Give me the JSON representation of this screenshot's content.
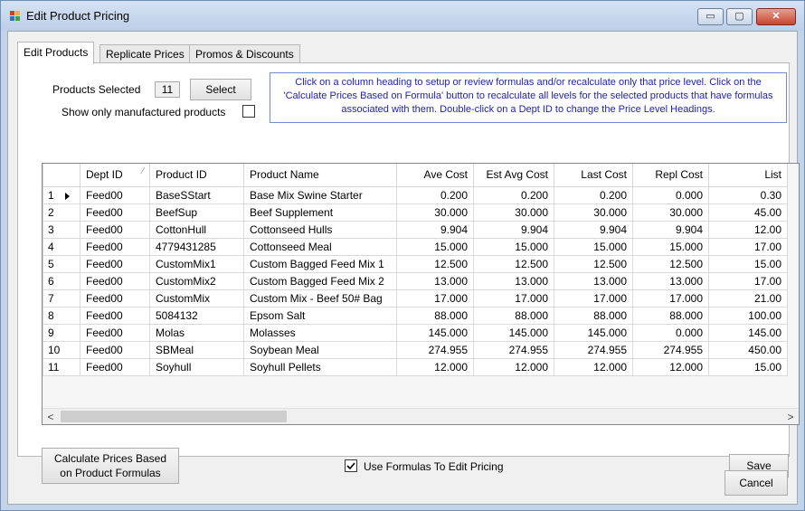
{
  "window": {
    "title": "Edit Product Pricing",
    "controls": {
      "minimize": "▭",
      "maximize": "▢",
      "close": "✕"
    }
  },
  "tabs": [
    {
      "label": "Edit Products",
      "active": true
    },
    {
      "label": "Replicate Prices",
      "active": false
    },
    {
      "label": "Promos & Discounts",
      "active": false
    }
  ],
  "selection": {
    "products_selected_label": "Products Selected",
    "products_selected_count": "11",
    "select_button": "Select",
    "manufactured_label": "Show only manufactured products",
    "manufactured_checked": false
  },
  "info_text": "Click on a column heading to setup or review formulas and/or recalculate only that price level. Click on the 'Calculate Prices Based on Formula' button to recalculate all levels for the selected products that have formulas associated with them. Double-click on a Dept ID to change the Price Level Headings.",
  "grid": {
    "columns": [
      "Dept ID",
      "Product ID",
      "Product Name",
      "Ave Cost",
      "Est Avg Cost",
      "Last Cost",
      "Repl Cost",
      "List"
    ],
    "sort_glyph": "⁄",
    "rows": [
      {
        "n": "1",
        "dept": "Feed00",
        "pid": "BaseSStart",
        "name": "Base Mix Swine Starter",
        "ave": "0.200",
        "est": "0.200",
        "last": "0.200",
        "repl": "0.000",
        "list": "0.30"
      },
      {
        "n": "2",
        "dept": "Feed00",
        "pid": "BeefSup",
        "name": "Beef Supplement",
        "ave": "30.000",
        "est": "30.000",
        "last": "30.000",
        "repl": "30.000",
        "list": "45.00"
      },
      {
        "n": "3",
        "dept": "Feed00",
        "pid": "CottonHull",
        "name": "Cottonseed Hulls",
        "ave": "9.904",
        "est": "9.904",
        "last": "9.904",
        "repl": "9.904",
        "list": "12.00"
      },
      {
        "n": "4",
        "dept": "Feed00",
        "pid": "4779431285",
        "name": "Cottonseed Meal",
        "ave": "15.000",
        "est": "15.000",
        "last": "15.000",
        "repl": "15.000",
        "list": "17.00"
      },
      {
        "n": "5",
        "dept": "Feed00",
        "pid": "CustomMix1",
        "name": "Custom Bagged Feed Mix 1",
        "ave": "12.500",
        "est": "12.500",
        "last": "12.500",
        "repl": "12.500",
        "list": "15.00"
      },
      {
        "n": "6",
        "dept": "Feed00",
        "pid": "CustomMix2",
        "name": "Custom Bagged Feed Mix 2",
        "ave": "13.000",
        "est": "13.000",
        "last": "13.000",
        "repl": "13.000",
        "list": "17.00"
      },
      {
        "n": "7",
        "dept": "Feed00",
        "pid": "CustomMix",
        "name": "Custom Mix - Beef 50# Bag",
        "ave": "17.000",
        "est": "17.000",
        "last": "17.000",
        "repl": "17.000",
        "list": "21.00"
      },
      {
        "n": "8",
        "dept": "Feed00",
        "pid": "5084132",
        "name": "Epsom Salt",
        "ave": "88.000",
        "est": "88.000",
        "last": "88.000",
        "repl": "88.000",
        "list": "100.00"
      },
      {
        "n": "9",
        "dept": "Feed00",
        "pid": "Molas",
        "name": "Molasses",
        "ave": "145.000",
        "est": "145.000",
        "last": "145.000",
        "repl": "0.000",
        "list": "145.00"
      },
      {
        "n": "10",
        "dept": "Feed00",
        "pid": "SBMeal",
        "name": "Soybean Meal",
        "ave": "274.955",
        "est": "274.955",
        "last": "274.955",
        "repl": "274.955",
        "list": "450.00"
      },
      {
        "n": "11",
        "dept": "Feed00",
        "pid": "Soyhull",
        "name": "Soyhull Pellets",
        "ave": "12.000",
        "est": "12.000",
        "last": "12.000",
        "repl": "12.000",
        "list": "15.00"
      }
    ],
    "current_row_index": 0,
    "scroll_left_glyph": "<",
    "scroll_right_glyph": ">"
  },
  "footer": {
    "calc_button_line1": "Calculate Prices Based",
    "calc_button_line2": "on Product Formulas",
    "use_formulas_label": "Use Formulas To Edit Pricing",
    "use_formulas_checked": true,
    "save_button": "Save",
    "cancel_button": "Cancel"
  },
  "colors": {
    "info_text": "#1d1db8",
    "title_bar": "#c3d4e9",
    "close_button": "#c7432f"
  }
}
